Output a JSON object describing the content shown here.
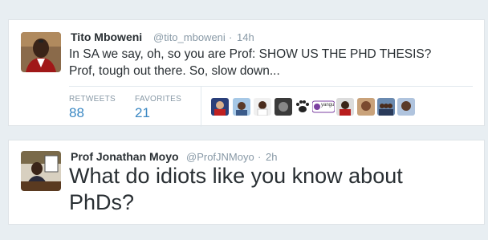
{
  "tweet1": {
    "author_name": "Tito Mboweni",
    "author_handle": "@tito_mboweni",
    "separator": "·",
    "time": "14h",
    "text_line1": "In SA we say, oh, so you are Prof: SHOW US THE PHD THESIS?",
    "text_line2": "Prof, tough out there. So, slow down...",
    "retweets_label": "RETWEETS",
    "retweets_count": "88",
    "favorites_label": "FAVORITES",
    "favorites_count": "21",
    "favoriters_badge_text": "yangu"
  },
  "tweet2": {
    "author_name": "Prof Jonathan Moyo",
    "author_handle": "@ProfJNMoyo",
    "separator": "·",
    "time": "2h",
    "text_line1": "What do idiots like you know about",
    "text_line2": "PhDs?"
  },
  "colors": {
    "page_bg": "#e8eef2",
    "card_bg": "#ffffff",
    "name": "#292f33",
    "handle": "#8899a6",
    "stat_value": "#3b88c3"
  }
}
